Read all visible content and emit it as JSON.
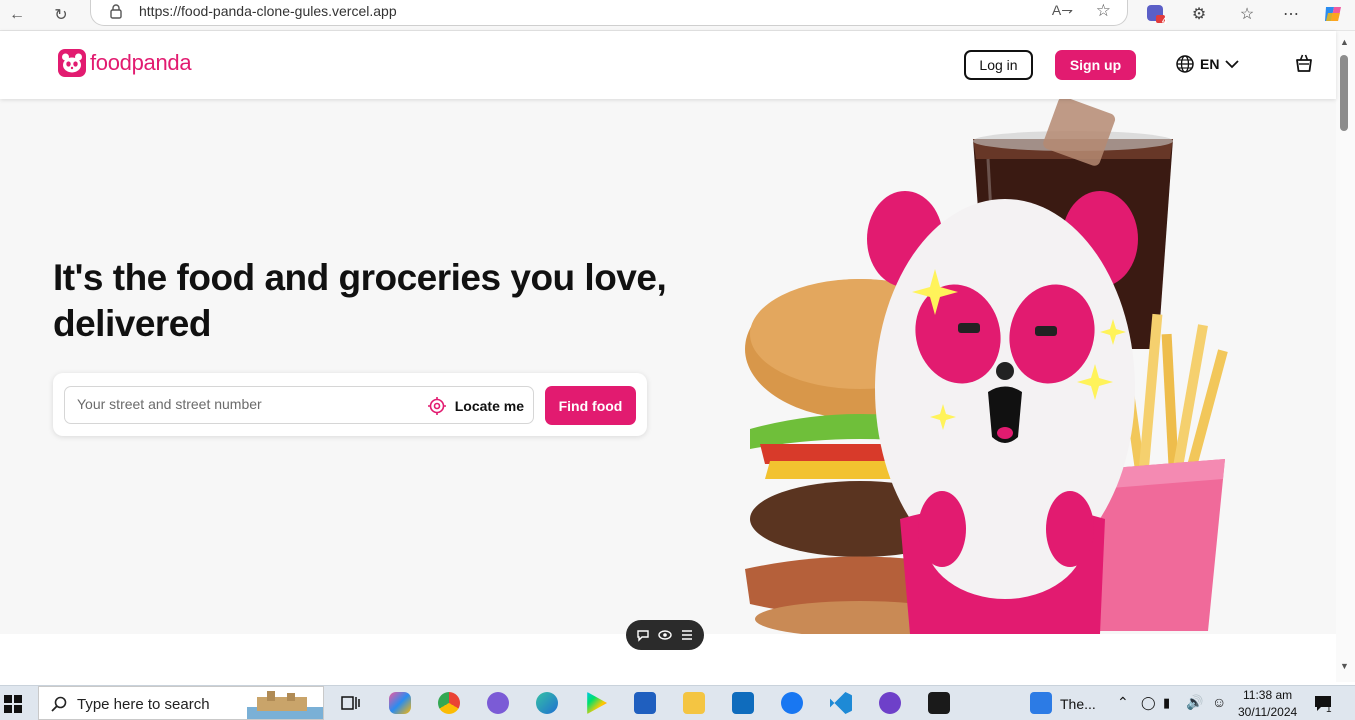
{
  "browser": {
    "url": "https://food-panda-clone-gules.vercel.app",
    "badge_count": "4"
  },
  "header": {
    "brand": "foodpanda",
    "login_label": "Log in",
    "signup_label": "Sign up",
    "language": "EN"
  },
  "hero": {
    "headline": "It's the food and groceries you love, delivered",
    "search_placeholder": "Your street and street number",
    "locate_label": "Locate me",
    "find_label": "Find food"
  },
  "taskbar": {
    "search_placeholder": "Type here to search",
    "app_label": "The...",
    "time": "11:38 am",
    "date": "30/11/2024",
    "notif_count": "1"
  },
  "colors": {
    "brand_pink": "#e21b70",
    "hero_bg": "#f7f7f7"
  }
}
